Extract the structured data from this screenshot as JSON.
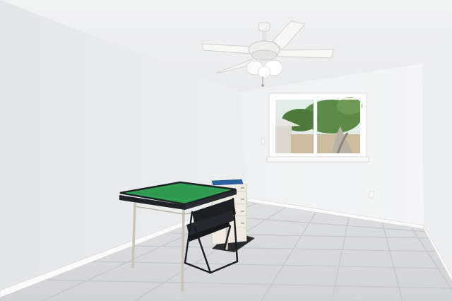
{
  "scene": {
    "kind": "photo-interior",
    "room": "empty bedroom",
    "objects": [
      "ceiling-fan",
      "window",
      "card-table",
      "folding-chair",
      "dresser",
      "book",
      "floor-mat",
      "light-switch",
      "wall-outlet"
    ]
  },
  "colors": {
    "ceiling": "#eff0f1",
    "left_wall": "#e9ebec",
    "back_wall": "#f3f4f5",
    "right_wall": "#edeff0",
    "floor": "#d8d9db",
    "floor_grout": "#c6c7ca",
    "baseboard": "#fafafa",
    "table_felt": "#2f9a4f",
    "table_frame": "#1e2226",
    "table_legs": "#cfc6b5",
    "chair": "#1d1f22",
    "dresser": "#eeeae1",
    "book": "#2a5f98",
    "fan_blade": "#f5f5f4",
    "window_frame": "#ffffff",
    "sky": "#dfe9e6",
    "foliage": "#4f7a3e",
    "fence": "#c9b79a"
  }
}
